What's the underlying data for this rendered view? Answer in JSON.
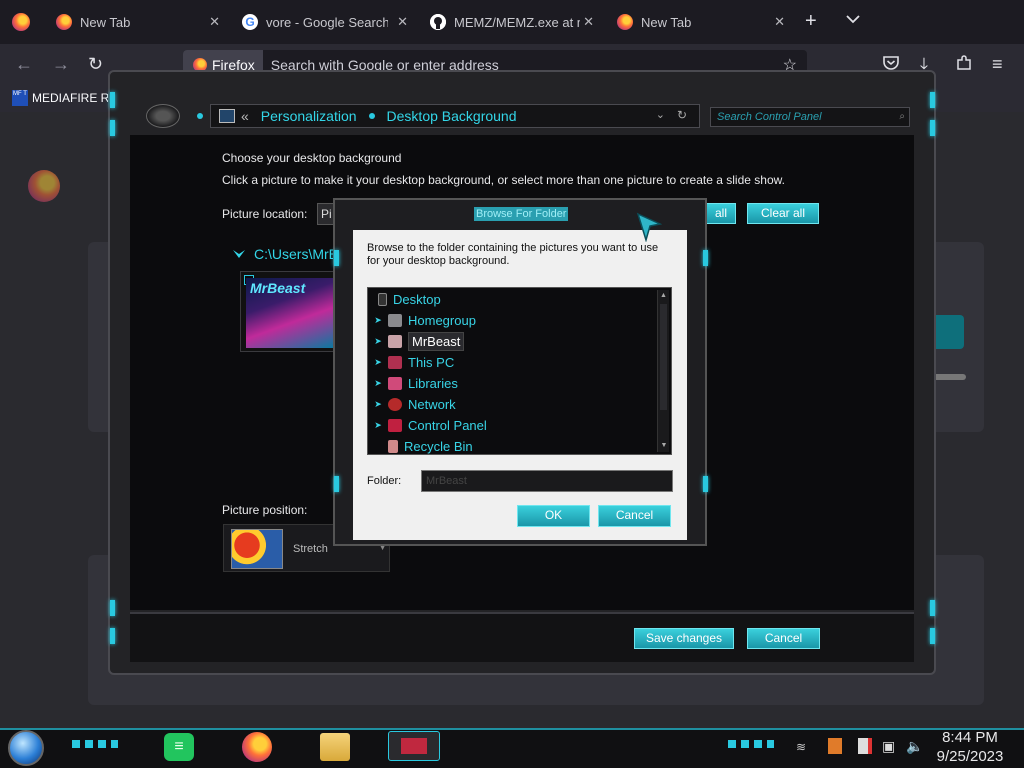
{
  "browser": {
    "tabs": [
      {
        "title": "New Tab",
        "icon": "firefox-icon"
      },
      {
        "title": "vore - Google Search",
        "icon": "google-icon"
      },
      {
        "title": "MEMZ/MEMZ.exe at m",
        "icon": "github-icon"
      },
      {
        "title": "New Tab",
        "icon": "firefox-icon"
      }
    ],
    "identity_label": "Firefox",
    "url_placeholder": "Search with Google or enter address",
    "bookmark": "MEDIAFIRE RO",
    "bookmark_icon_text": "MF T"
  },
  "control_panel": {
    "breadcrumb_sep": "«",
    "breadcrumb": [
      "Personalization",
      "Desktop Background"
    ],
    "search_placeholder": "Search Control Panel",
    "heading": "Choose your desktop background",
    "instructions": "Click a picture to make it your desktop background, or select more than one picture to create a slide show.",
    "picture_location_label": "Picture location:",
    "picture_location_value": "Pi",
    "select_all_label": "all",
    "clear_all_label": "Clear all",
    "folder_path": "C:\\Users\\MrB",
    "thumbnail_text": "MrBeast",
    "picture_position_label": "Picture position:",
    "picture_position_value": "Stretch",
    "save_label": "Save changes",
    "cancel_label": "Cancel"
  },
  "dialog": {
    "title": "Browse For Folder",
    "description": "Browse to the folder containing the pictures you want to use for your desktop background.",
    "tree": [
      {
        "label": "Desktop",
        "expandable": false,
        "icon": "desktop-icon"
      },
      {
        "label": "Homegroup",
        "expandable": true,
        "icon": "homegroup-icon"
      },
      {
        "label": "MrBeast",
        "expandable": true,
        "icon": "user-folder-icon",
        "selected": true
      },
      {
        "label": "This PC",
        "expandable": true,
        "icon": "computer-icon"
      },
      {
        "label": "Libraries",
        "expandable": true,
        "icon": "libraries-icon"
      },
      {
        "label": "Network",
        "expandable": true,
        "icon": "network-icon"
      },
      {
        "label": "Control Panel",
        "expandable": true,
        "icon": "control-panel-icon"
      },
      {
        "label": "Recycle Bin",
        "expandable": false,
        "icon": "recycle-bin-icon"
      }
    ],
    "folder_label": "Folder:",
    "folder_value": "MrBeast",
    "ok_label": "OK",
    "cancel_label": "Cancel"
  },
  "taskbar": {
    "time": "8:44 PM",
    "date": "9/25/2023"
  },
  "colors": {
    "accent": "#29c9e0",
    "firefox_bg": "#1c1b22",
    "toolbar_bg": "#2b2a33"
  }
}
